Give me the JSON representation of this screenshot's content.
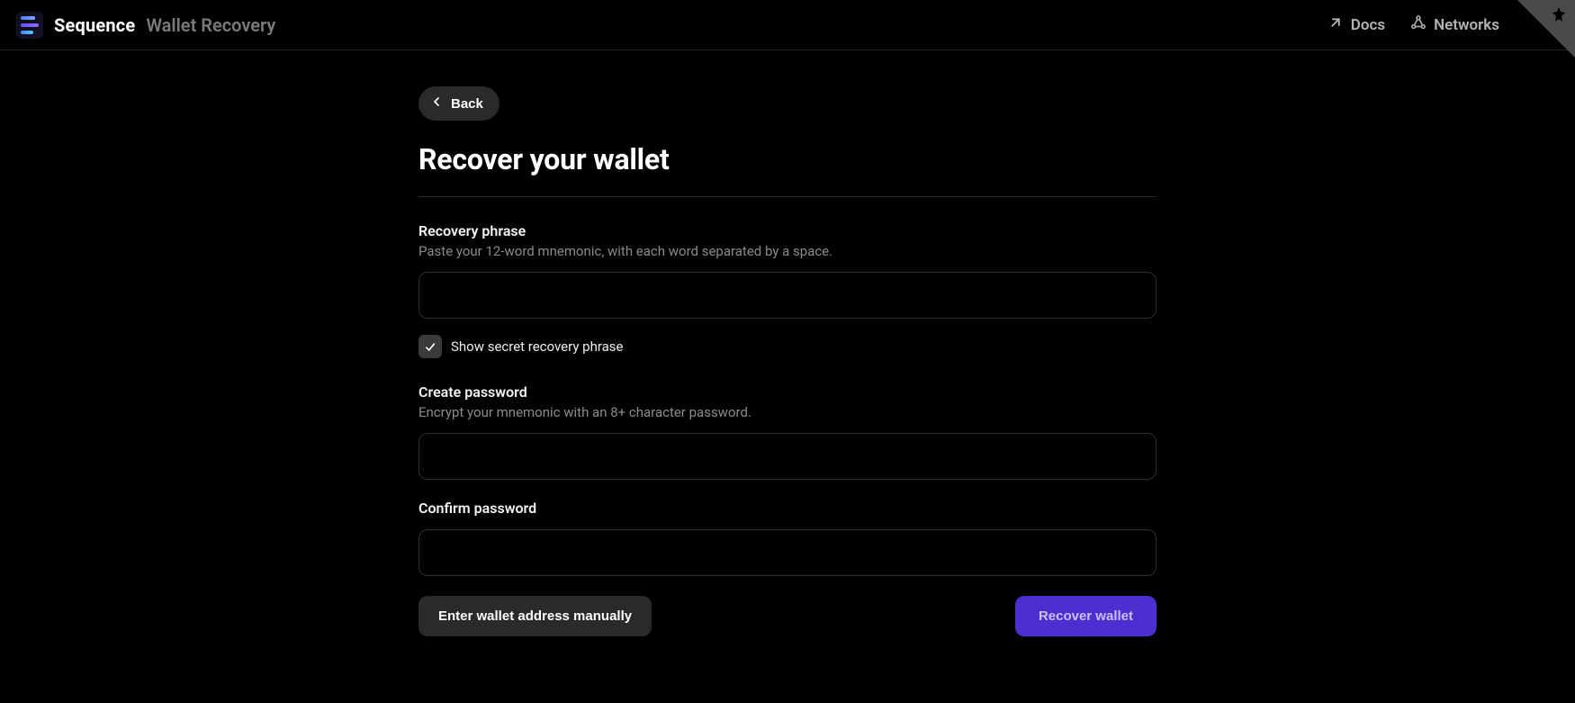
{
  "header": {
    "brand": "Sequence",
    "subtitle": "Wallet Recovery",
    "docs_label": "Docs",
    "networks_label": "Networks"
  },
  "page": {
    "back_label": "Back",
    "title": "Recover your wallet"
  },
  "recovery": {
    "label": "Recovery phrase",
    "desc": "Paste your 12-word mnemonic, with each word separated by a space.",
    "show_label": "Show secret recovery phrase",
    "show_checked": true
  },
  "password": {
    "create_label": "Create password",
    "create_desc": "Encrypt your mnemonic with an 8+ character password.",
    "confirm_label": "Confirm password"
  },
  "footer": {
    "manual_label": "Enter wallet address manually",
    "recover_label": "Recover wallet"
  }
}
